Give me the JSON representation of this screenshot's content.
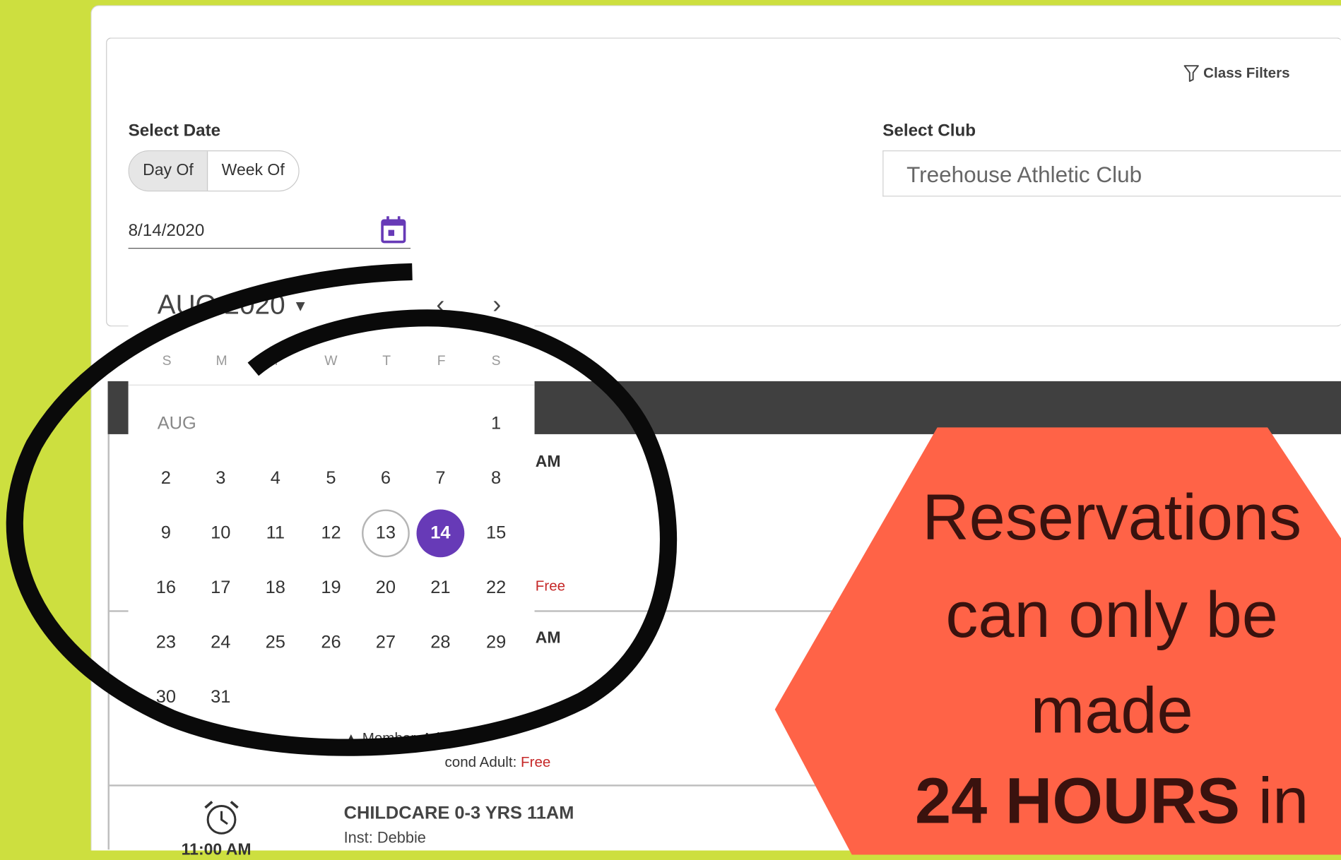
{
  "header": {
    "class_filters_label": "Class Filters"
  },
  "select_date": {
    "label": "Select Date",
    "toggle_options": [
      "Day Of",
      "Week Of"
    ],
    "active_option": "Day Of",
    "value": "8/14/2020"
  },
  "select_club": {
    "label": "Select Club",
    "value": "Treehouse Athletic Club"
  },
  "calendar": {
    "month_title": "AUG 2020",
    "month_label": "AUG",
    "weekdays": [
      "S",
      "M",
      "T",
      "W",
      "T",
      "F",
      "S"
    ],
    "days": [
      "1",
      "2",
      "3",
      "4",
      "5",
      "6",
      "7",
      "8",
      "9",
      "10",
      "11",
      "12",
      "13",
      "14",
      "15",
      "16",
      "17",
      "18",
      "19",
      "20",
      "21",
      "22",
      "23",
      "24",
      "25",
      "26",
      "27",
      "28",
      "29",
      "30",
      "31"
    ],
    "today": "13",
    "selected": "14",
    "accent_color": "#673ab7"
  },
  "schedule_fragments": {
    "row1_time_fragment": "AM",
    "row1_price_fragment": "Free",
    "row2_time_fragment": "AM",
    "row2_member_fragment": "Member, Adult:",
    "row2_second_adult_fragment": "cond Adult:",
    "row2_price": "Free",
    "row3_title": "CHILDCARE 0-3 YRS 11AM",
    "row3_instructor": "Inst: Debbie",
    "row3_time": "11:00 AM"
  },
  "promo": {
    "lines": [
      "Reservations",
      "can only be",
      "made"
    ],
    "emphasis": "24 HOURS",
    "trailing": "in",
    "background_color": "#ff6347",
    "text_color": "#3a120e"
  },
  "colors": {
    "page_background": "#cddf3f",
    "header_band": "#404040"
  }
}
